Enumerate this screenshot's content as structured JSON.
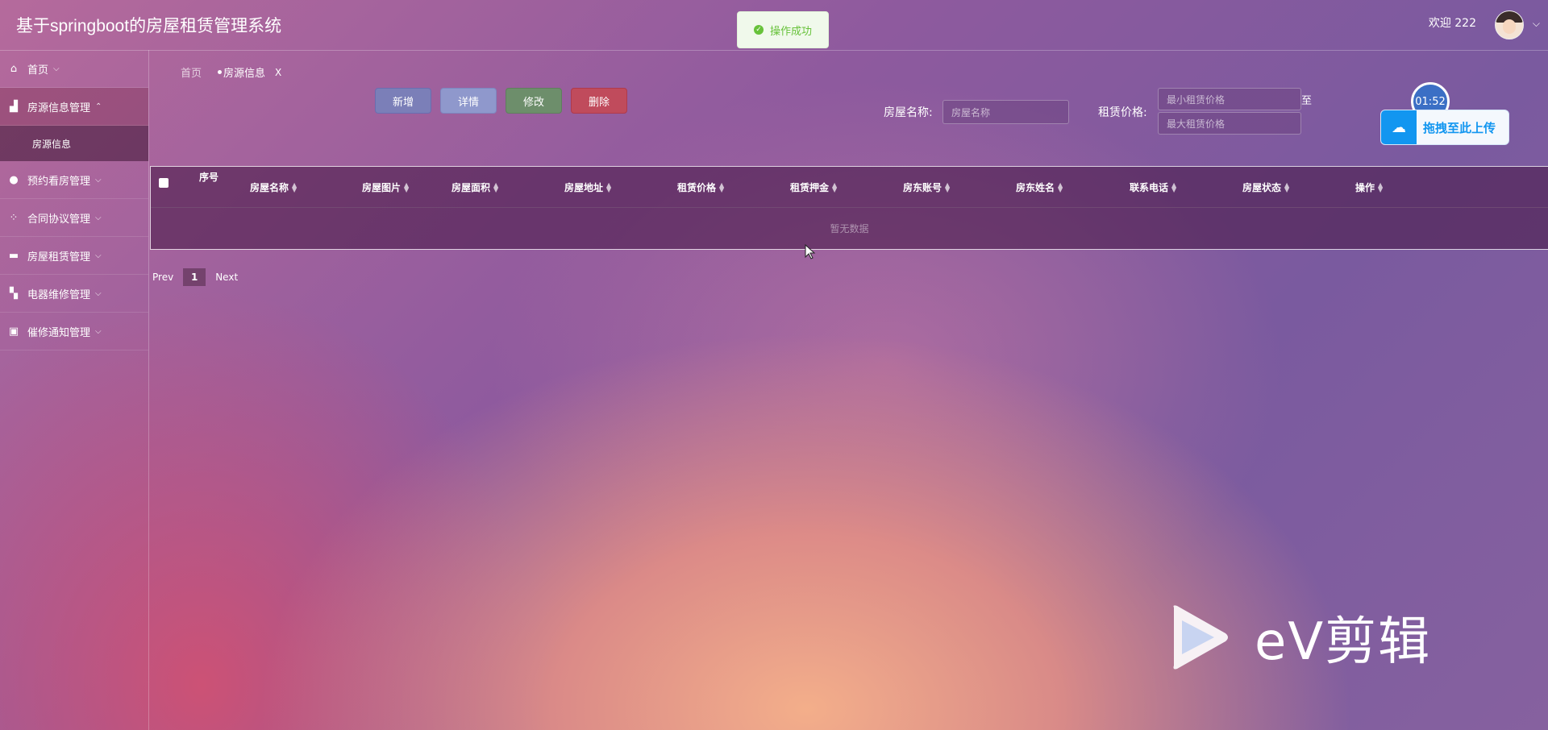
{
  "app": {
    "title": "基于springboot的房屋租赁管理系统",
    "welcome": "欢迎 222"
  },
  "toast": {
    "message": "操作成功"
  },
  "sidebar": {
    "items": [
      {
        "label": "首页",
        "icon": "home-icon"
      },
      {
        "label": "房源信息管理",
        "icon": "building-icon",
        "expanded": true
      },
      {
        "label": "房源信息",
        "submenu": true
      },
      {
        "label": "预约看房管理",
        "icon": "calendar-icon"
      },
      {
        "label": "合同协议管理",
        "icon": "apps-icon"
      },
      {
        "label": "房屋租赁管理",
        "icon": "ticket-icon"
      },
      {
        "label": "电器维修管理",
        "icon": "tool-icon"
      },
      {
        "label": "催修通知管理",
        "icon": "gift-icon"
      }
    ]
  },
  "breadcrumb": {
    "home": "首页",
    "current": "房源信息",
    "close": "X"
  },
  "toolbar": {
    "add": "新增",
    "detail": "详情",
    "edit": "修改",
    "delete": "删除"
  },
  "search": {
    "name_label": "房屋名称:",
    "name_placeholder": "房屋名称",
    "price_label": "租赁价格:",
    "min_placeholder": "最小租赁价格",
    "max_placeholder": "最大租赁价格",
    "to": "至"
  },
  "clock": "01:52",
  "upload": {
    "label": "拖拽至此上传"
  },
  "table": {
    "columns": [
      "序号",
      "房屋名称",
      "房屋图片",
      "房屋面积",
      "房屋地址",
      "租赁价格",
      "租赁押金",
      "房东账号",
      "房东姓名",
      "联系电话",
      "房屋状态",
      "操作"
    ],
    "empty": "暂无数据"
  },
  "pager": {
    "prev": "Prev",
    "page": "1",
    "next": "Next"
  },
  "watermark": {
    "text": "eV剪辑"
  }
}
